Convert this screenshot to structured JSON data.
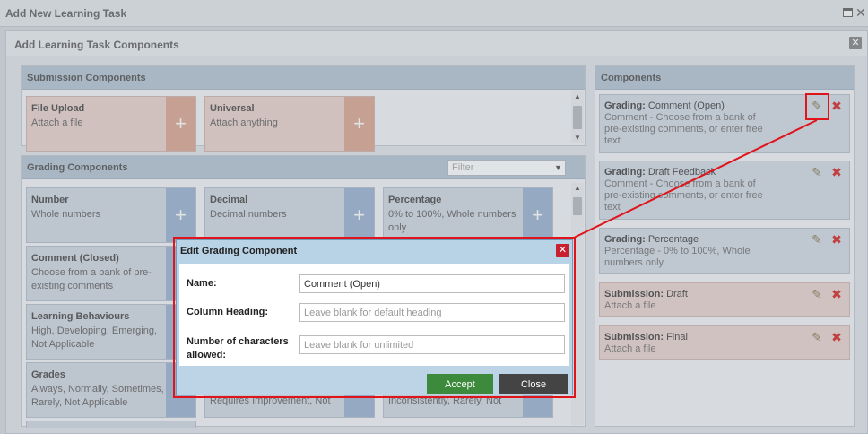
{
  "window": {
    "title": "Add New Learning Task"
  },
  "inner_window": {
    "title": "Add Learning Task Components"
  },
  "submission_panel": {
    "header": "Submission Components",
    "cards": [
      {
        "name": "File Upload",
        "description": "Attach a file",
        "add": "+"
      },
      {
        "name": "Universal",
        "description": "Attach anything",
        "add": "+"
      }
    ]
  },
  "grading_panel": {
    "header": "Grading Components",
    "filter_placeholder": "Filter",
    "cards": [
      {
        "name": "Number",
        "description": "Whole numbers",
        "add": "+"
      },
      {
        "name": "Decimal",
        "description": "Decimal numbers",
        "add": "+"
      },
      {
        "name": "Percentage",
        "description": "0% to 100%, Whole numbers only",
        "add": "+"
      },
      {
        "name": "Comment (Closed)",
        "description": "Choose from a bank of pre-existing comments",
        "add": "+"
      },
      {
        "name": "Learning Behaviours",
        "description": "High, Developing, Emerging, Not Applicable",
        "add": "+"
      },
      {
        "name": "Grades",
        "description": "Always, Normally, Sometimes, Rarely, Not Applicable",
        "add": "+"
      },
      {
        "name": "",
        "description": "Requires Improvement, Not",
        "add": "+"
      },
      {
        "name": "",
        "description": "Inconsistently, Rarely, Not",
        "add": "+"
      }
    ]
  },
  "components_panel": {
    "header": "Components",
    "items": [
      {
        "type": "Grading:",
        "name": "Comment (Open)",
        "description": "Comment - Choose from a bank of pre-existing comments, or enter free text"
      },
      {
        "type": "Grading:",
        "name": "Draft Feedback",
        "description": "Comment - Choose from a bank of pre-existing comments, or enter free text"
      },
      {
        "type": "Grading:",
        "name": "Percentage",
        "description": "Percentage - 0% to 100%, Whole numbers only"
      },
      {
        "type": "Submission:",
        "name": "Draft",
        "description": "Attach a file"
      },
      {
        "type": "Submission:",
        "name": "Final",
        "description": "Attach a file"
      }
    ]
  },
  "dialog": {
    "title": "Edit Grading Component",
    "close": "✕",
    "fields": {
      "name_label": "Name:",
      "name_value": "Comment (Open)",
      "heading_label": "Column Heading:",
      "heading_placeholder": "Leave blank for default heading",
      "chars_label_line1": "Number of characters",
      "chars_label_line2": "allowed:",
      "chars_placeholder": "Leave blank for unlimited"
    },
    "accept_label": "Accept",
    "close_label": "Close"
  },
  "icons": {
    "pencil": "pencil-icon",
    "delete": "delete-icon",
    "plus": "plus-icon"
  },
  "colors": {
    "highlight": "#e0141b",
    "accept": "#3d8a3c",
    "delete": "#c91818"
  }
}
